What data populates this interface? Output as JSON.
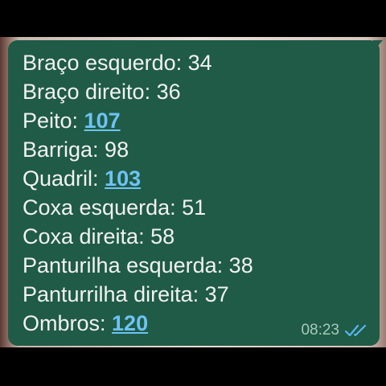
{
  "message": {
    "lines": [
      {
        "label": "Braço esquerdo: ",
        "value": "34",
        "link": false
      },
      {
        "label": "Braço direito: ",
        "value": "36",
        "link": false
      },
      {
        "label": "Peito: ",
        "value": "107",
        "link": true
      },
      {
        "label": "Barriga: ",
        "value": "98",
        "link": false
      },
      {
        "label": "Quadril: ",
        "value": "103",
        "link": true
      },
      {
        "label": "Coxa esquerda: ",
        "value": "51",
        "link": false
      },
      {
        "label": "Coxa direita: ",
        "value": "58",
        "link": false
      },
      {
        "label": "Panturilha esquerda: ",
        "value": "38",
        "link": false
      },
      {
        "label": "Panturrilha direita: ",
        "value": "37",
        "link": false
      },
      {
        "label": "Ombros: ",
        "value": "120",
        "link": true
      }
    ],
    "time": "08:23",
    "status_icon": "double-check-read-icon"
  },
  "colors": {
    "bubble": "#1f5b46",
    "text": "#f2f2f2",
    "link": "#6ec3f4",
    "time": "#a7c9bb",
    "ticks": "#5ab4f0"
  }
}
